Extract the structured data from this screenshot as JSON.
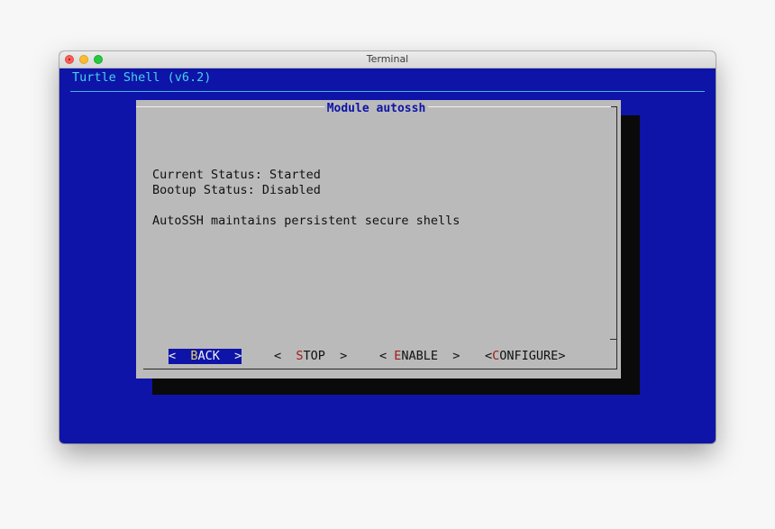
{
  "window": {
    "title": "Terminal"
  },
  "terminal": {
    "backtitle": "Turtle Shell (v6.2)"
  },
  "dialog": {
    "title": "Module autossh",
    "lines": [
      "Current Status: Started",
      "Bootup Status: Disabled",
      "",
      "AutoSSH maintains persistent secure shells"
    ],
    "buttons": [
      {
        "open": "<  ",
        "hotkey": "B",
        "rest": "ACK",
        "close": "  >",
        "selected": true
      },
      {
        "open": "<  ",
        "hotkey": "S",
        "rest": "TOP",
        "close": "  >",
        "selected": false
      },
      {
        "open": "< ",
        "hotkey": "E",
        "rest": "NABLE",
        "close": "  >",
        "selected": false
      },
      {
        "open": "<",
        "hotkey": "C",
        "rest": "ONFIGURE",
        "close": ">",
        "selected": false
      }
    ]
  },
  "colors": {
    "terminal_background": "#0e14a8",
    "backtitle": "#45d3e6",
    "dialog_background": "#bababa",
    "dialog_title": "#0e14a8",
    "hotkey": "#a01e14",
    "selected_hotkey": "#e8d061"
  }
}
